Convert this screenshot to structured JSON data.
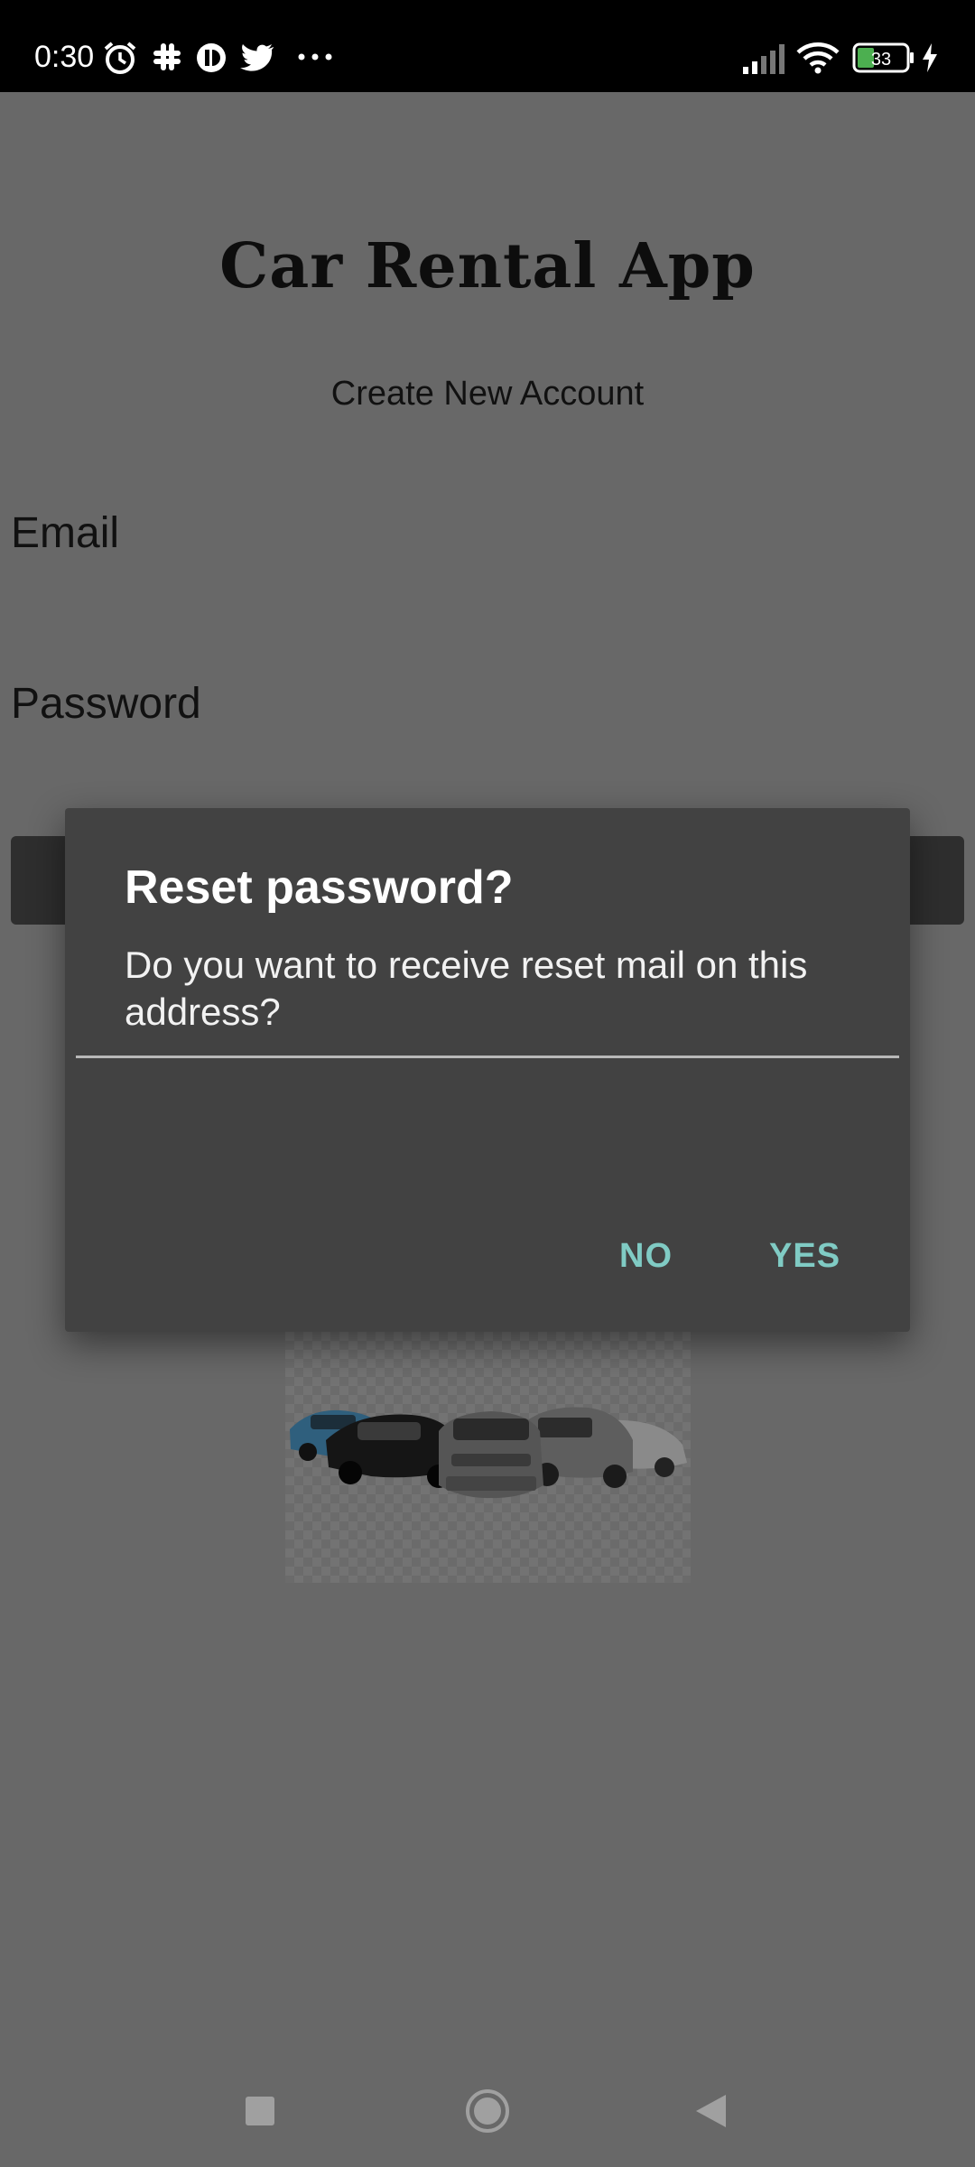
{
  "status_bar": {
    "time": "0:30",
    "battery": "33",
    "icons": [
      "alarm-icon",
      "slack-icon",
      "app-icon",
      "twitter-icon",
      "more-icon",
      "signal-icon",
      "wifi-icon",
      "battery-icon",
      "charging-icon"
    ]
  },
  "app": {
    "title": "Car Rental App",
    "subtitle": "Create New Account",
    "email_label": "Email",
    "password_label": "Password"
  },
  "dialog": {
    "title": "Reset password?",
    "message": "Do you want to receive reset mail on this address?",
    "input_value": "",
    "no_label": "NO",
    "yes_label": "YES",
    "accent_color": "#80cbc4"
  },
  "nav_bar": {
    "icons": [
      "recents-icon",
      "home-icon",
      "back-icon"
    ]
  }
}
